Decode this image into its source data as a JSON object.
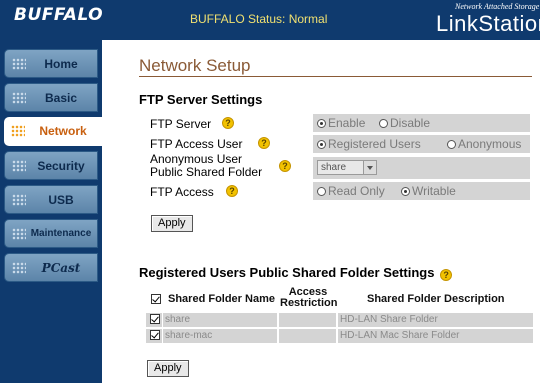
{
  "header": {
    "brand": "BUFFALO",
    "status": "BUFFALO Status: Normal",
    "product_subtitle": "Network Attached Storage",
    "product_name": "LinkStation"
  },
  "sidebar": {
    "items": [
      {
        "label": "Home",
        "active": false
      },
      {
        "label": "Basic",
        "active": false
      },
      {
        "label": "Network",
        "active": true
      },
      {
        "label": "Security",
        "active": false
      },
      {
        "label": "USB",
        "active": false
      },
      {
        "label": "Maintenance",
        "active": false
      },
      {
        "label": "PCast",
        "active": false
      }
    ]
  },
  "main": {
    "title": "Network Setup",
    "ftp_section": {
      "heading": "FTP Server Settings",
      "ftp_server": {
        "label": "FTP Server",
        "options": [
          "Enable",
          "Disable"
        ],
        "selected": "Enable"
      },
      "ftp_access_user": {
        "label": "FTP Access User",
        "options": [
          "Registered Users",
          "Anonymous"
        ],
        "selected": "Registered Users"
      },
      "anon_folder": {
        "label_line1": "Anonymous User",
        "label_line2": "Public Shared Folder",
        "value": "share"
      },
      "ftp_access": {
        "label": "FTP Access",
        "options": [
          "Read Only",
          "Writable"
        ],
        "selected": "Writable"
      },
      "apply_label": "Apply"
    },
    "reg_section": {
      "heading": "Registered Users Public Shared Folder Settings",
      "columns": {
        "name": "Shared Folder Name",
        "access_line1": "Access",
        "access_line2": "Restriction",
        "description": "Shared Folder Description"
      },
      "rows": [
        {
          "checked": true,
          "name": "share",
          "access": "",
          "description": "HD-LAN Share Folder"
        },
        {
          "checked": true,
          "name": "share-mac",
          "access": "",
          "description": "HD-LAN Mac Share Folder"
        }
      ],
      "apply_label": "Apply"
    }
  },
  "colors": {
    "header_bg": "#0f3a6e",
    "status_text": "#f0e070",
    "title_text": "#8a5a36",
    "help_icon": "#f2c200",
    "active_nav_text": "#c86010"
  }
}
